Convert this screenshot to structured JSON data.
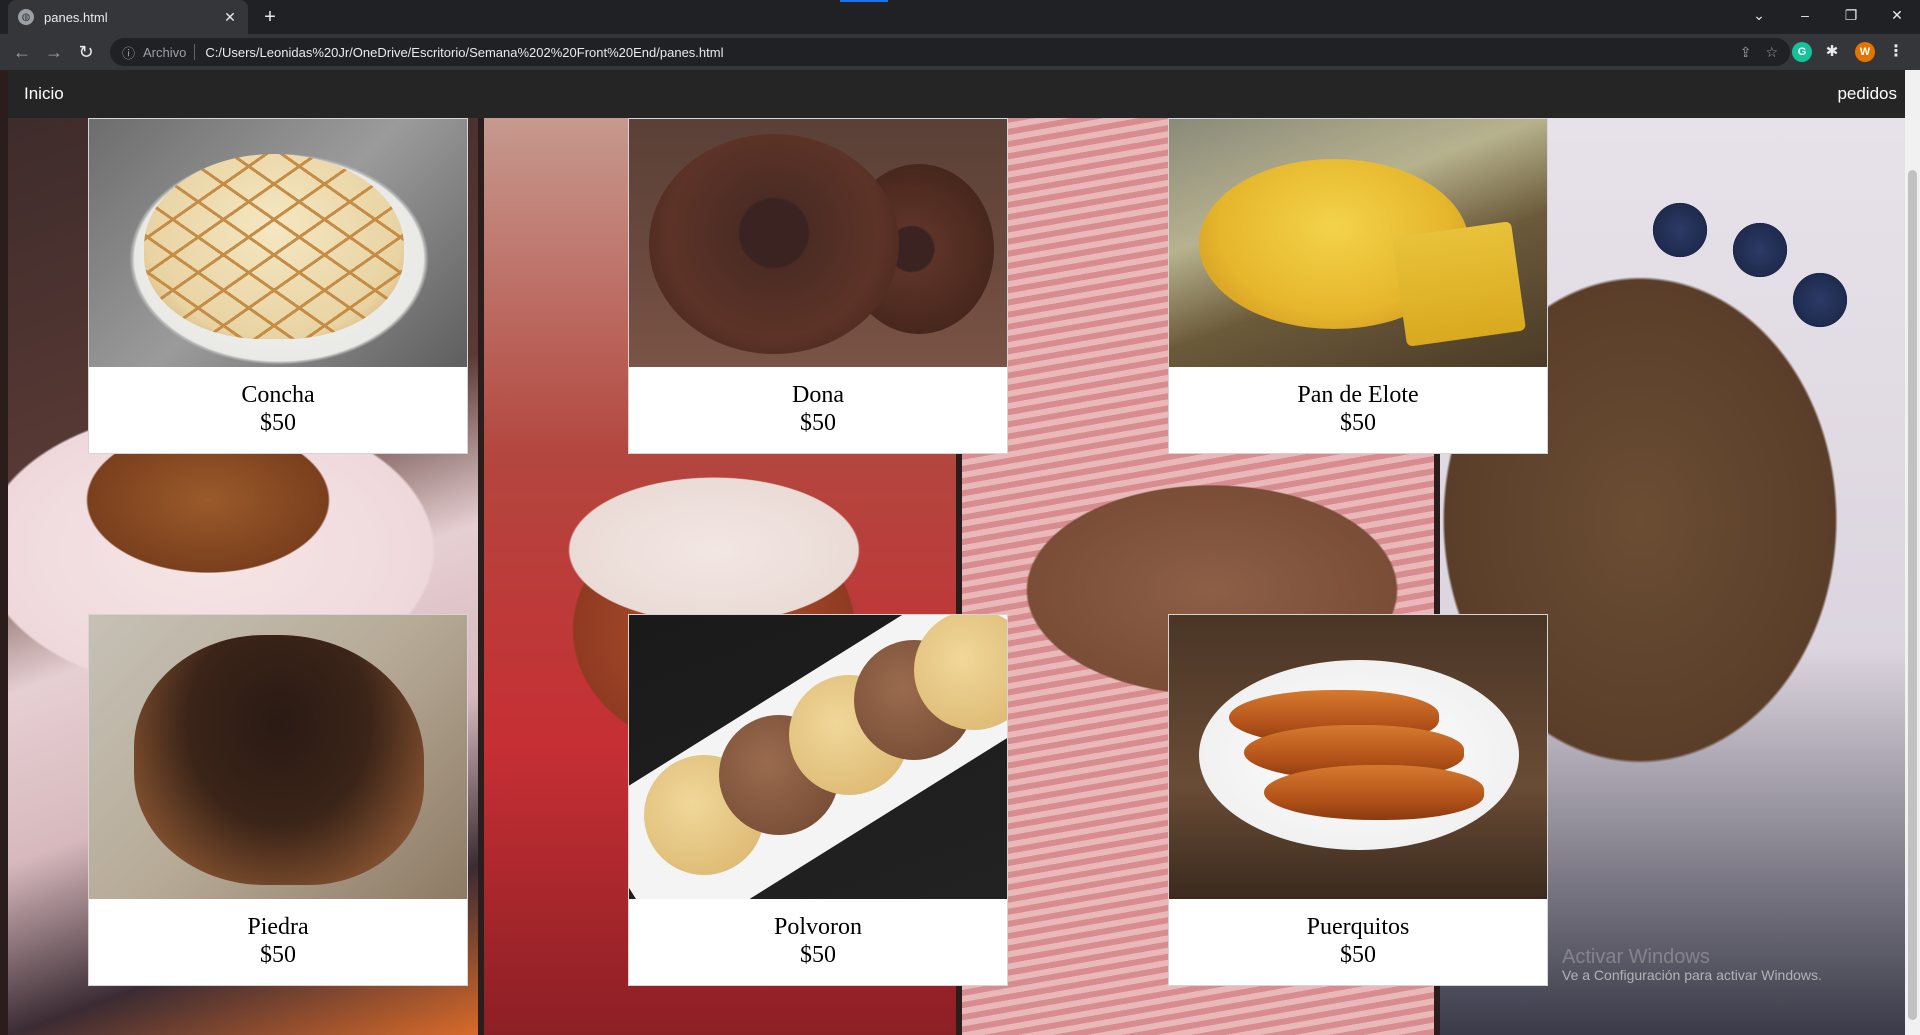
{
  "browser": {
    "tab_title": "panes.html",
    "tab_close": "✕",
    "new_tab": "+",
    "scheme_label": "Archivo",
    "url": "C:/Users/Leonidas%20Jr/OneDrive/Escritorio/Semana%202%20Front%20End/panes.html",
    "profile_initial": "W",
    "grammarly_initial": "G"
  },
  "navbar": {
    "left_link": "Inicio",
    "right_link": "pedidos"
  },
  "products": [
    {
      "name": "Concha",
      "price": "$50"
    },
    {
      "name": "Dona",
      "price": "$50"
    },
    {
      "name": "Pan de Elote",
      "price": "$50"
    },
    {
      "name": "Piedra",
      "price": "$50"
    },
    {
      "name": "Polvoron",
      "price": "$50"
    },
    {
      "name": "Puerquitos",
      "price": "$50"
    }
  ],
  "watermark": {
    "title": "Activar Windows",
    "subtitle": "Ve a Configuración para activar Windows."
  },
  "colors": {
    "navbar_bg": "#252525",
    "chrome_bg": "#202124",
    "toolbar_bg": "#35363a",
    "accent": "#1a73e8"
  }
}
